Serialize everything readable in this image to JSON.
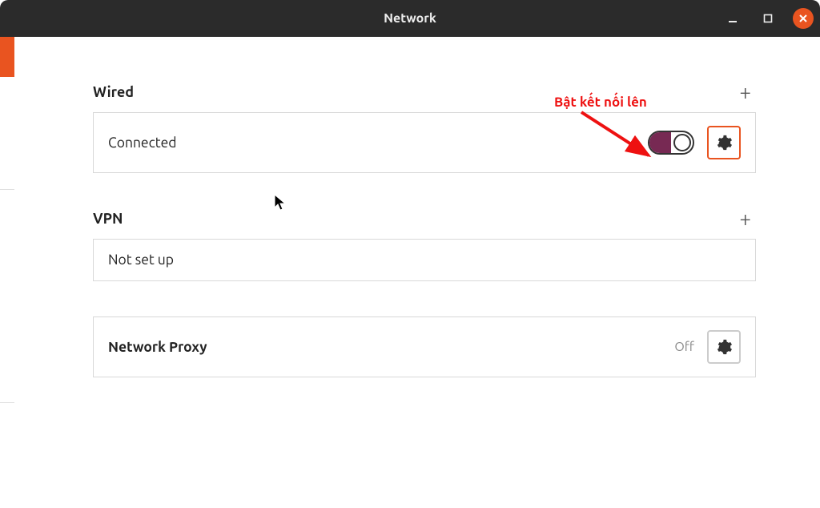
{
  "titlebar": {
    "title": "Network"
  },
  "annotation": {
    "text": "Bật kết nối lên"
  },
  "sections": {
    "wired": {
      "title": "Wired",
      "status": "Connected",
      "toggle_on": true
    },
    "vpn": {
      "title": "VPN",
      "status": "Not set up"
    },
    "proxy": {
      "title": "Network Proxy",
      "status": "Off"
    }
  }
}
